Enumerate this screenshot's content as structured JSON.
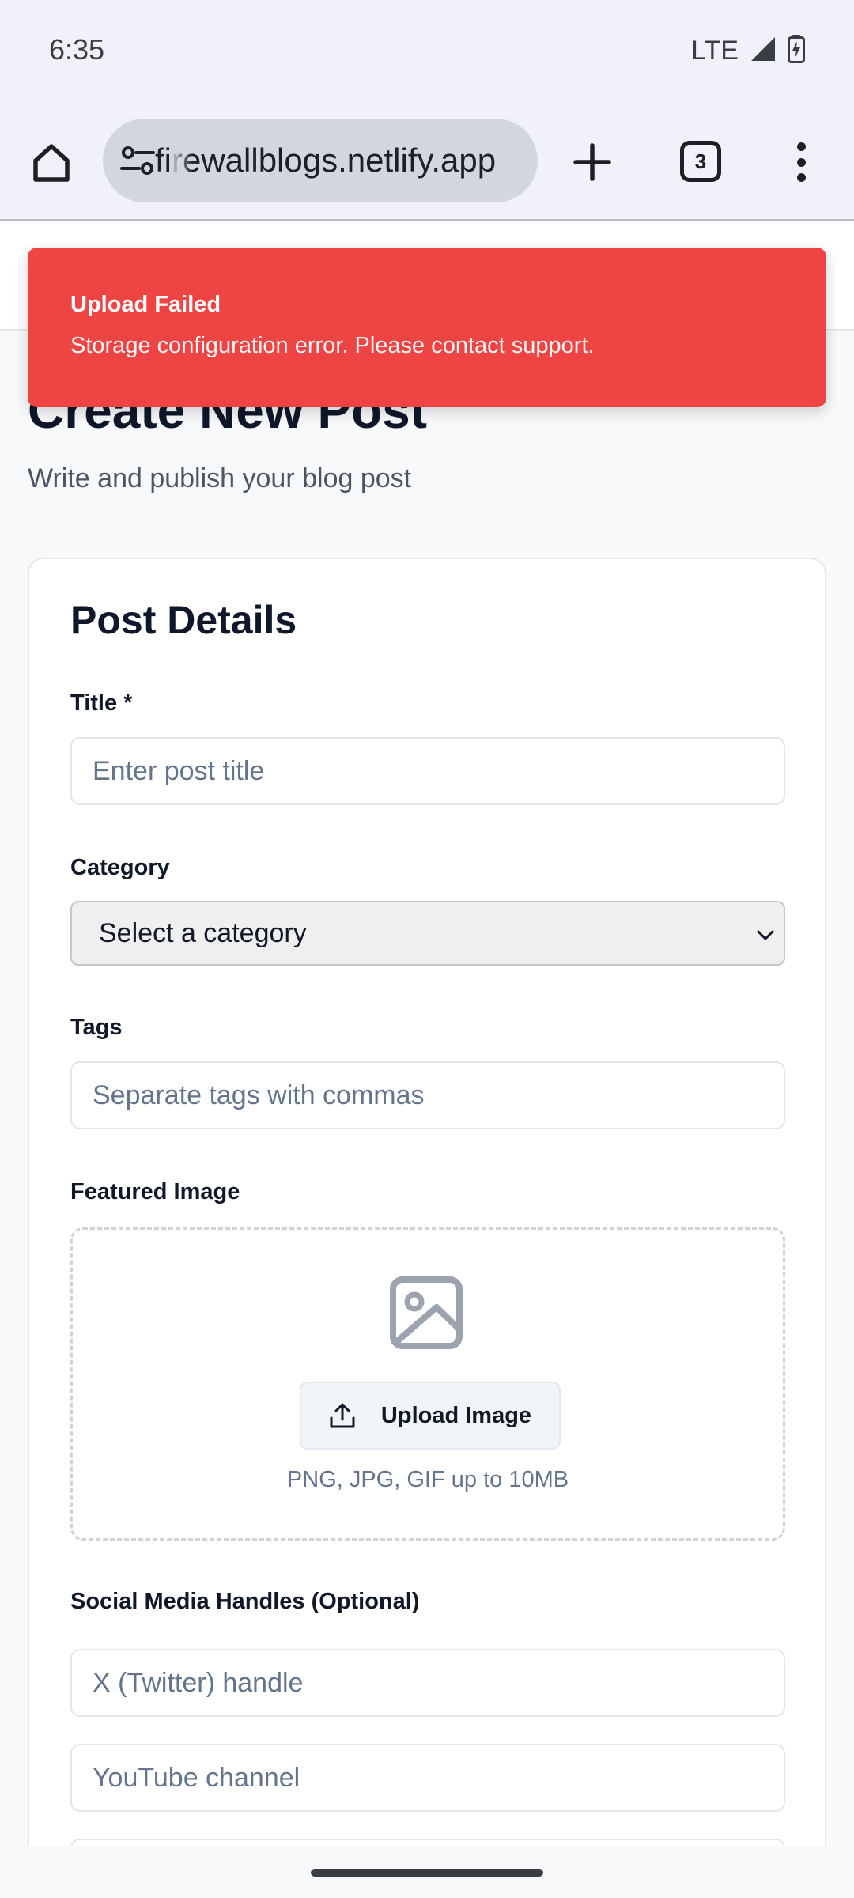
{
  "status_bar": {
    "time": "6:35",
    "network": "LTE",
    "signal_icon": "cell-signal-icon",
    "battery_icon": "battery-charging-icon"
  },
  "browser": {
    "url": "firewallblogs.netlify.app",
    "tab_count": "3",
    "icons": [
      "home-icon",
      "site-settings-icon",
      "plus-icon",
      "tab-switcher-icon",
      "more-vert-icon"
    ]
  },
  "toast": {
    "title": "Upload Failed",
    "message": "Storage configuration error. Please contact support.",
    "color": "#ef4444"
  },
  "page": {
    "title": "Create New Post",
    "subtitle": "Write and publish your blog post"
  },
  "form": {
    "heading": "Post Details",
    "title_label": "Title *",
    "title_placeholder": "Enter post title",
    "category_label": "Category",
    "category_value": "Select a category",
    "tags_label": "Tags",
    "tags_placeholder": "Separate tags with commas",
    "image_label": "Featured Image",
    "upload_button": "Upload Image",
    "upload_hint": "PNG, JPG, GIF up to 10MB",
    "social_label": "Social Media Handles (Optional)",
    "twitter_placeholder": "X (Twitter) handle",
    "youtube_placeholder": "YouTube channel"
  }
}
